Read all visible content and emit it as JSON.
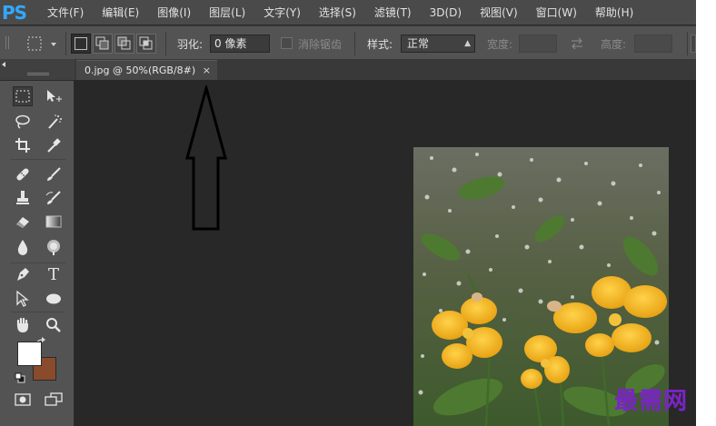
{
  "app": {
    "logo": "PS",
    "brand_color": "#31a8ff"
  },
  "menu": [
    "文件(F)",
    "编辑(E)",
    "图像(I)",
    "图层(L)",
    "文字(Y)",
    "选择(S)",
    "滤镜(T)",
    "3D(D)",
    "视图(V)",
    "窗口(W)",
    "帮助(H)"
  ],
  "options": {
    "feather_label": "羽化:",
    "feather_value": "0 像素",
    "antialias_label": "消除锯齿",
    "style_label": "样式:",
    "style_value": "正常",
    "width_label": "宽度:",
    "height_label": "高度:"
  },
  "document": {
    "tab_title": "0.jpg @ 50%(RGB/8#)",
    "close_glyph": "×"
  },
  "tools": [
    "rectangular-marquee-icon",
    "move-icon",
    "lasso-icon",
    "magic-wand-icon",
    "crop-icon",
    "eyedropper-icon",
    "spot-healing-icon",
    "brush-icon",
    "clone-stamp-icon",
    "history-brush-icon",
    "eraser-icon",
    "gradient-icon",
    "blur-icon",
    "dodge-icon",
    "pen-icon",
    "type-icon",
    "path-selection-icon",
    "ellipse-icon",
    "hand-icon",
    "zoom-icon",
    "quick-mask-icon",
    "screen-mode-icon"
  ],
  "type_tool_glyph": "T",
  "colors": {
    "foreground": "#ffffff",
    "background": "#8a4a2c"
  },
  "watermark": "最需网",
  "watermark_color": "#7b23c8"
}
